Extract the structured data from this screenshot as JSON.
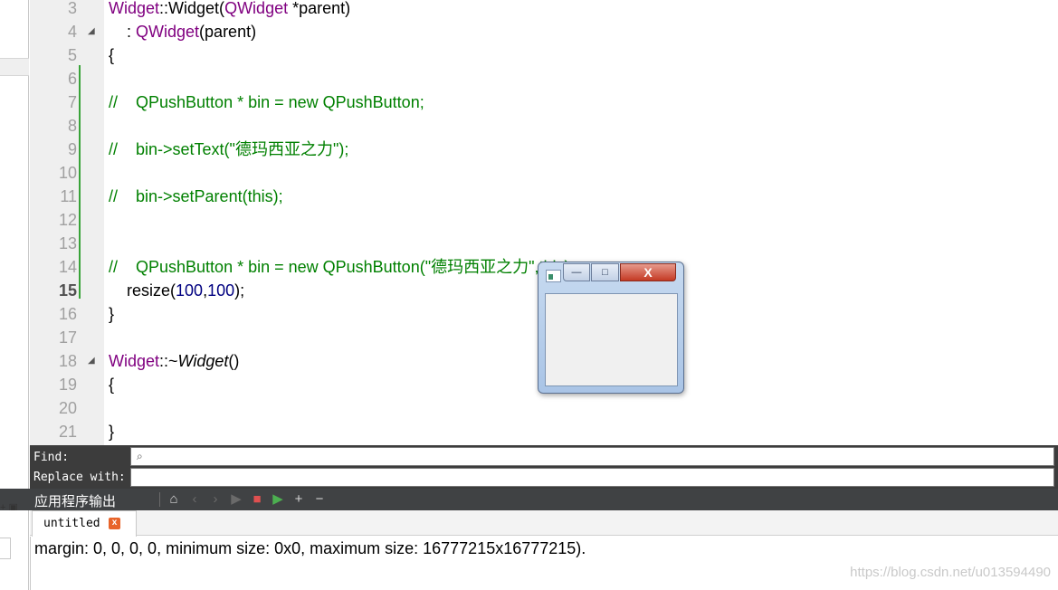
{
  "editor": {
    "lines": [
      {
        "num": "3",
        "parts": [
          {
            "t": "Widget",
            "c": "purple"
          },
          {
            "t": "::Widget(",
            "c": "plain"
          },
          {
            "t": "QWidget",
            "c": "purple"
          },
          {
            "t": " *parent)",
            "c": "plain"
          }
        ]
      },
      {
        "num": "4",
        "fold": true,
        "parts": [
          {
            "t": "    : ",
            "c": "plain"
          },
          {
            "t": "QWidget",
            "c": "purple"
          },
          {
            "t": "(parent)",
            "c": "plain"
          }
        ]
      },
      {
        "num": "5",
        "parts": [
          {
            "t": "{",
            "c": "plain"
          }
        ]
      },
      {
        "num": "6",
        "parts": []
      },
      {
        "num": "7",
        "parts": [
          {
            "t": "//    QPushButton * bin = new QPushButton;",
            "c": "green"
          }
        ]
      },
      {
        "num": "8",
        "parts": []
      },
      {
        "num": "9",
        "parts": [
          {
            "t": "//    bin->setText(\"德玛西亚之力\");",
            "c": "green"
          }
        ]
      },
      {
        "num": "10",
        "parts": []
      },
      {
        "num": "11",
        "parts": [
          {
            "t": "//    bin->setParent(this);",
            "c": "green"
          }
        ]
      },
      {
        "num": "12",
        "parts": []
      },
      {
        "num": "13",
        "parts": []
      },
      {
        "num": "14",
        "parts": [
          {
            "t": "//    QPushButton * bin = new QPushButton(\"德玛西亚之力\",this);",
            "c": "green"
          }
        ]
      },
      {
        "num": "15",
        "current": true,
        "parts": [
          {
            "t": "    resize(",
            "c": "plain"
          },
          {
            "t": "100",
            "c": "navy"
          },
          {
            "t": ",",
            "c": "plain"
          },
          {
            "t": "100",
            "c": "navy"
          },
          {
            "t": ");",
            "c": "plain"
          }
        ]
      },
      {
        "num": "16",
        "parts": [
          {
            "t": "}",
            "c": "plain"
          }
        ]
      },
      {
        "num": "17",
        "parts": []
      },
      {
        "num": "18",
        "fold": true,
        "parts": [
          {
            "t": "Widget",
            "c": "purple"
          },
          {
            "t": "::~",
            "c": "plain"
          },
          {
            "t": "Widget",
            "c": "italic"
          },
          {
            "t": "()",
            "c": "plain"
          }
        ]
      },
      {
        "num": "19",
        "parts": [
          {
            "t": "{",
            "c": "plain"
          }
        ]
      },
      {
        "num": "20",
        "parts": []
      },
      {
        "num": "21",
        "parts": [
          {
            "t": "}",
            "c": "plain"
          }
        ]
      }
    ]
  },
  "popup": {
    "minimize_glyph": "—",
    "maximize_glyph": "□",
    "close_glyph": "X"
  },
  "findbar": {
    "find_label": "Find:",
    "replace_label": "Replace with:",
    "find_value": "",
    "replace_value": "",
    "search_glyph": "⌕"
  },
  "output_pane": {
    "title": "应用程序输出",
    "toolbar": {
      "clear_glyph": "⌂",
      "prev_glyph": "‹",
      "next_glyph": "›",
      "run_glyph": "▶",
      "stop_glyph": "■",
      "debug_glyph": "▶",
      "zoom_in_glyph": "+",
      "zoom_out_glyph": "−"
    },
    "left_mini": "+ ▣",
    "tab_label": "untitled",
    "tab_close_glyph": "x",
    "text": "margin: 0, 0, 0, 0, minimum size: 0x0, maximum size: 16777215x16777215)."
  },
  "watermark": "https://blog.csdn.net/u013594490",
  "colors": {
    "keyword_purple": "#800080",
    "comment_green": "#008000",
    "number_navy": "#000080",
    "change_bar": "#39a339"
  }
}
